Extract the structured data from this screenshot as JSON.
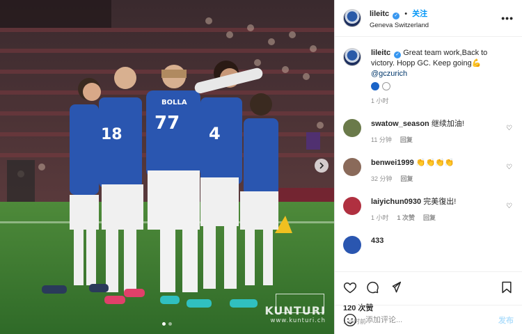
{
  "post": {
    "username": "lileitc",
    "follow_label": "关注",
    "location": "Geneva Switzerland",
    "more_label": "•••"
  },
  "caption": {
    "username": "lileitc",
    "text": "Great team work,Back to victory. Hopp GC. Keep going",
    "emoji": "💪",
    "mention": "@gczurich",
    "time": "1 小时"
  },
  "comments": [
    {
      "username": "swatow_season",
      "text": "继续加油!",
      "time": "11 分钟",
      "reply": "回复",
      "likes": "",
      "avatar_color": "#6a7a4a"
    },
    {
      "username": "benwei1999",
      "text": "👏👏👏👏",
      "time": "32 分钟",
      "reply": "回复",
      "likes": "",
      "avatar_color": "#8a6a5a"
    },
    {
      "username": "laiyichun0930",
      "text": "完美復出!",
      "time": "1 小时",
      "reply": "回复",
      "likes": "1 次赞",
      "avatar_color": "#b03040"
    }
  ],
  "partial_comment": {
    "username": "433"
  },
  "stats": {
    "likes": "120 次赞",
    "time": "1 小时前"
  },
  "add_comment": {
    "placeholder": "添加评论...",
    "post_label": "发布"
  },
  "photo": {
    "watermark_name": "KUNTURI",
    "watermark_url": "www.kunturi.ch",
    "jersey_name": "BOLLA",
    "jersey_number_1": "77",
    "jersey_number_2": "18",
    "jersey_number_3": "4",
    "carousel_count": 2,
    "carousel_active": 0
  },
  "colors": {
    "accent": "#0095f6",
    "verified": "#3897f0",
    "jersey_blue": "#2a56b0"
  }
}
